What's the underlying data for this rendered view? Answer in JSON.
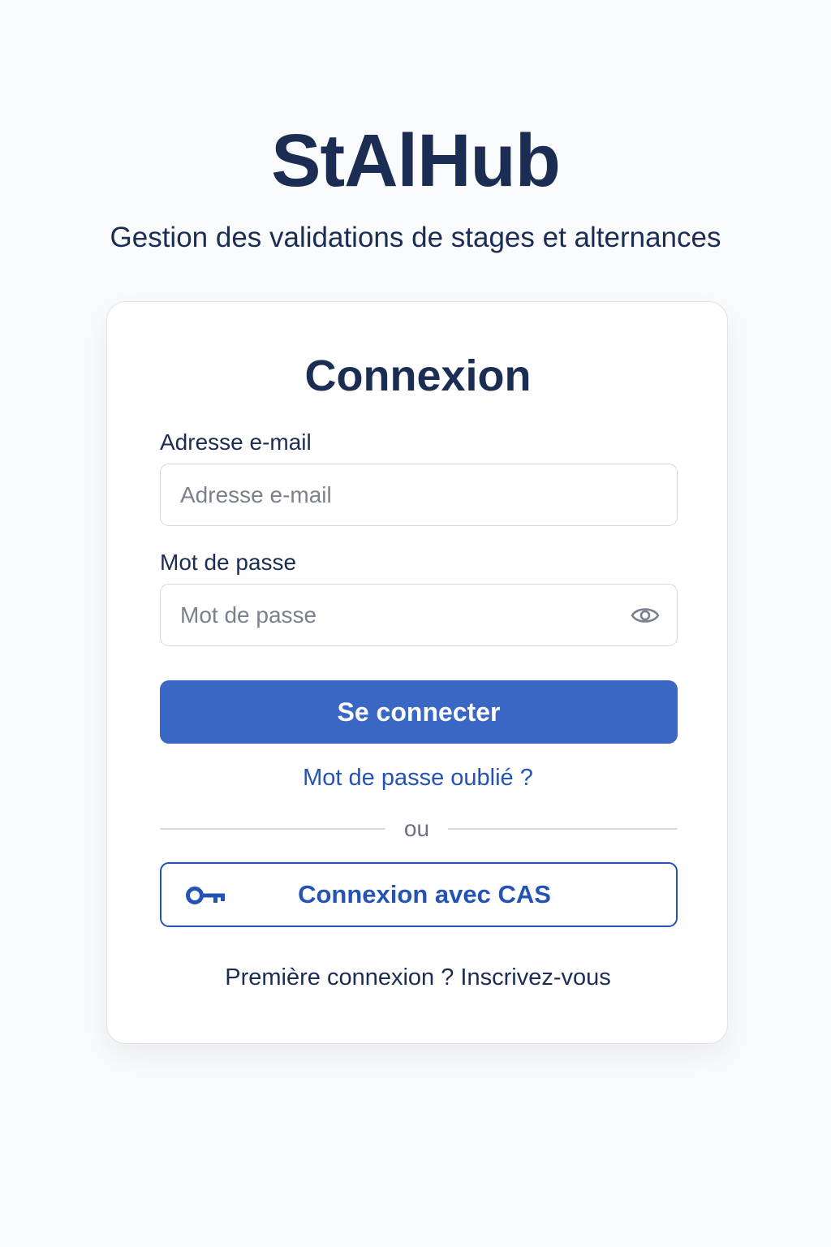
{
  "header": {
    "title": "StAlHub",
    "subtitle": "Gestion des validations de stages et alternances"
  },
  "login_card": {
    "title": "Connexion",
    "email": {
      "label": "Adresse e-mail",
      "placeholder": "Adresse e-mail",
      "value": ""
    },
    "password": {
      "label": "Mot de passe",
      "placeholder": "Mot de passe",
      "value": "",
      "toggle_icon": "eye-icon"
    },
    "submit_label": "Se connecter",
    "forgot_password_link": "Mot de passe oublié ?",
    "divider_text": "ou",
    "cas_button": {
      "label": "Connexion avec CAS",
      "icon": "key-icon"
    },
    "signup_text": "Première connexion ? Inscrivez-vous"
  },
  "colors": {
    "background": "#f9fafb",
    "primary": "#3a66c4",
    "link": "#2553b5",
    "text": "#1b2d52"
  }
}
